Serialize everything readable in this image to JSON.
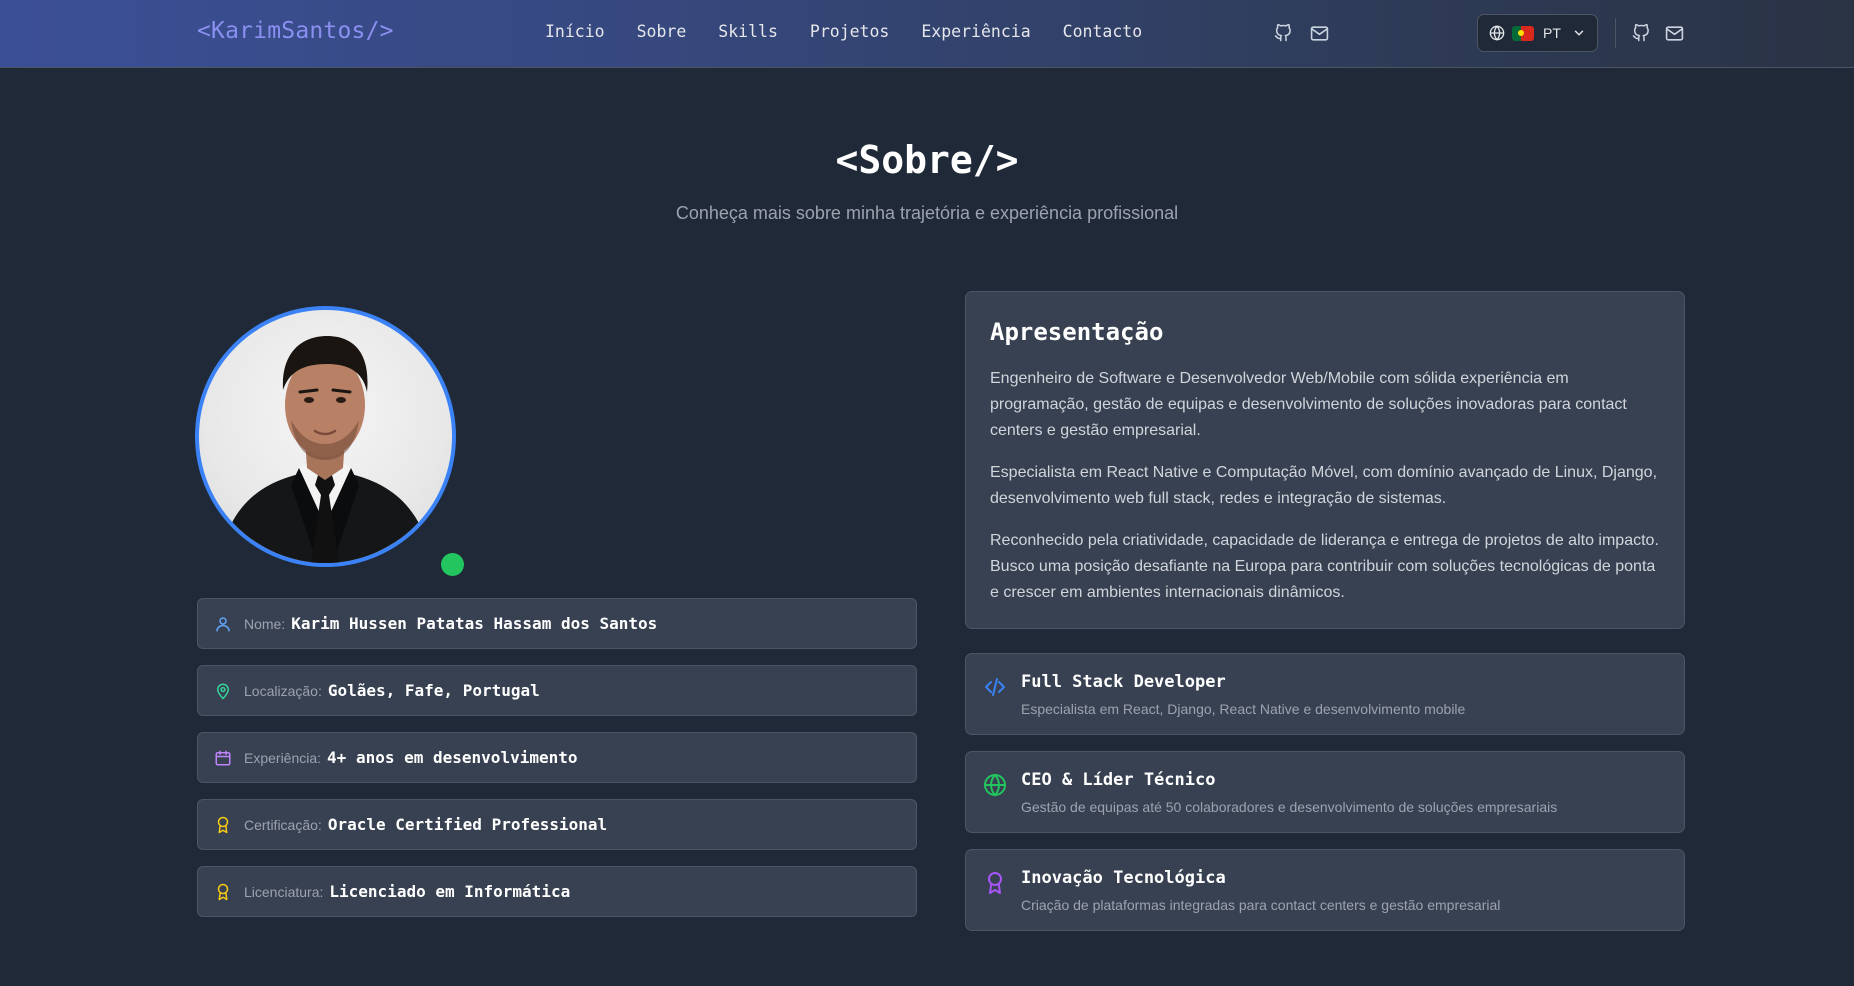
{
  "header": {
    "logo": "<KarimSantos/>",
    "nav": [
      "Início",
      "Sobre",
      "Skills",
      "Projetos",
      "Experiência",
      "Contacto"
    ],
    "lang_code": "PT"
  },
  "section": {
    "title": "<Sobre/>",
    "subtitle": "Conheça mais sobre minha trajetória e experiência profissional"
  },
  "profile": {
    "info": [
      {
        "label": "Nome:",
        "value": "Karim Hussen Patatas Hassam dos Santos",
        "icon": "user-icon",
        "color": "#60a5fa"
      },
      {
        "label": "Localização:",
        "value": "Golães, Fafe, Portugal",
        "icon": "map-pin-icon",
        "color": "#34d399"
      },
      {
        "label": "Experiência:",
        "value": "4+ anos em desenvolvimento",
        "icon": "calendar-icon",
        "color": "#c084fc"
      },
      {
        "label": "Certificação:",
        "value": "Oracle Certified Professional",
        "icon": "award-icon",
        "color": "#facc15"
      },
      {
        "label": "Licenciatura:",
        "value": "Licenciado em Informática",
        "icon": "award-icon",
        "color": "#facc15"
      }
    ]
  },
  "presentation": {
    "title": "Apresentação",
    "paragraphs": [
      "Engenheiro de Software e Desenvolvedor Web/Mobile com sólida experiência em programação, gestão de equipas e desenvolvimento de soluções inovadoras para contact centers e gestão empresarial.",
      "Especialista em React Native e Computação Móvel, com domínio avançado de Linux, Django, desenvolvimento web full stack, redes e integração de sistemas.",
      "Reconhecido pela criatividade, capacidade de liderança e entrega de projetos de alto impacto. Busco uma posição desafiante na Europa para contribuir com soluções tecnológicas de ponta e crescer em ambientes internacionais dinâmicos."
    ]
  },
  "features": [
    {
      "title": "Full Stack Developer",
      "desc": "Especialista em React, Django, React Native e desenvolvimento mobile",
      "icon": "code-icon",
      "color": "#3b82f6"
    },
    {
      "title": "CEO & Líder Técnico",
      "desc": "Gestão de equipas até 50 colaboradores e desenvolvimento de soluções empresariais",
      "icon": "globe-icon",
      "color": "#22c55e"
    },
    {
      "title": "Inovação Tecnológica",
      "desc": "Criação de plataformas integradas para contact centers e gestão empresarial",
      "icon": "award-icon",
      "color": "#a855f7"
    }
  ],
  "colors": {
    "accent": "#3b82f6",
    "status": "#22c55e",
    "background": "#1f2937",
    "card": "#374151"
  }
}
